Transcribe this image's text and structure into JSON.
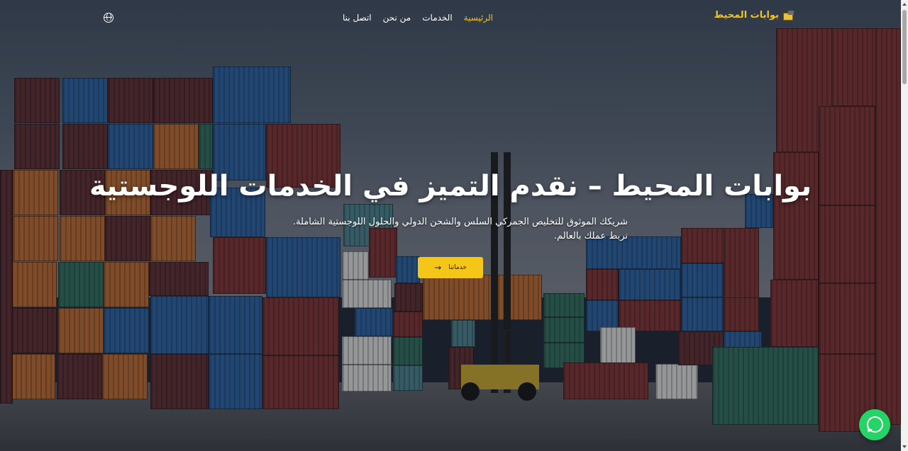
{
  "nav": {
    "brand": "بوابات المحيط",
    "links": [
      "الرئيسية",
      "الخدمات",
      "من نحن",
      "اتصل بنا"
    ],
    "active_index": 0,
    "language_icon": "globe-icon"
  },
  "hero": {
    "title": "بوابات المحيط – نقدم التميز في الخدمات اللوجستية",
    "subtitle": "شريكك الموثوق للتخليص الجمركي السلس والشحن الدولي والحلول اللوجستية الشاملة. نربط عملك بالعالم.",
    "cta_label": "خدماتنا",
    "cta_icon": "arrow-right-icon",
    "background_description_icon": "container-yard-image"
  },
  "floating": {
    "whatsapp_icon": "whatsapp-icon"
  },
  "colors": {
    "accent": "#f5c518",
    "whatsapp": "#25d366",
    "text": "#ffffff"
  }
}
